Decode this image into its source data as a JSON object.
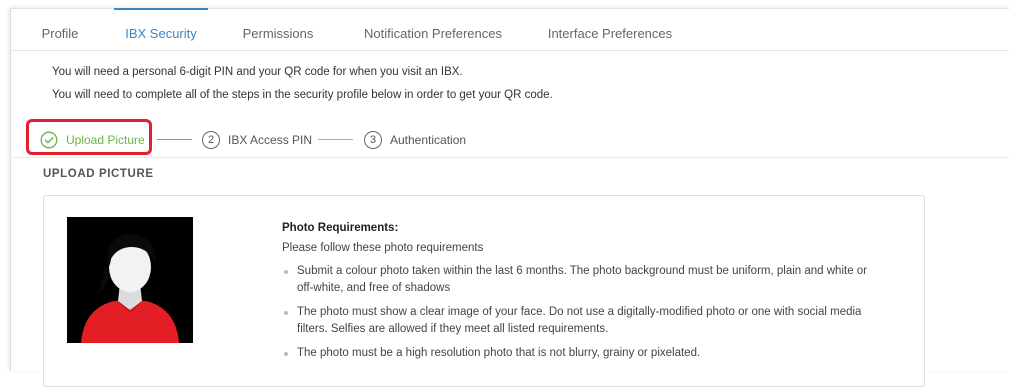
{
  "tabs": [
    {
      "label": "Profile",
      "active": false
    },
    {
      "label": "IBX Security",
      "active": true
    },
    {
      "label": "Permissions",
      "active": false
    },
    {
      "label": "Notification Preferences",
      "active": false
    },
    {
      "label": "Interface Preferences",
      "active": false
    }
  ],
  "info": {
    "line1": "You will need a personal 6-digit PIN and your QR code for when you visit an IBX.",
    "line2": "You will need to complete all of the steps in the security profile below in order to get your QR code."
  },
  "steps": [
    {
      "label": "Upload Picture",
      "number": "",
      "status": "done",
      "icon": "check-circle-icon"
    },
    {
      "label": "IBX Access PIN",
      "number": "2",
      "status": "pending"
    },
    {
      "label": "Authentication",
      "number": "3",
      "status": "pending"
    }
  ],
  "section": {
    "title": "UPLOAD PICTURE"
  },
  "requirements": {
    "title": "Photo Requirements:",
    "intro": "Please follow these photo requirements",
    "items": [
      "Submit a colour photo taken within the last 6 months. The photo background must be uniform, plain and white or off-white, and free of shadows",
      "The photo must show a clear image of your face. Do not use a digitally-modified photo or one with social media filters. Selfies are allowed if they meet all listed requirements.",
      "The photo must be a high resolution photo that is not blurry, grainy or pixelated."
    ]
  },
  "colors": {
    "accent": "#3b87c6",
    "success": "#6bb34a",
    "highlight": "#e0202a",
    "avatar_shirt": "#e31e24"
  }
}
